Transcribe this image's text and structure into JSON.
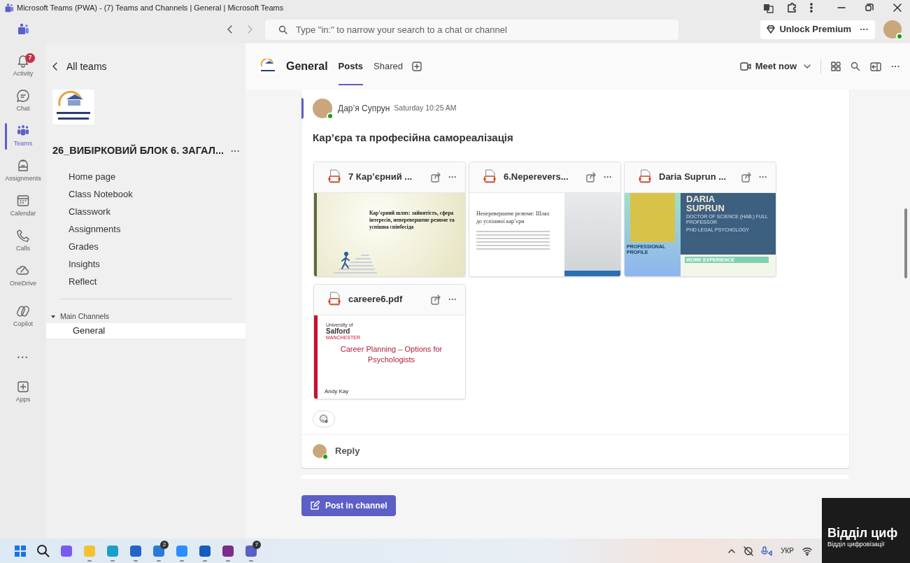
{
  "window": {
    "title": "Microsoft Teams (PWA) - (7) Teams and Channels | General | Microsoft Teams"
  },
  "top_bar": {
    "search": {
      "placeholder": "Type \"in:\" to narrow your search to a chat or channel"
    },
    "premium_button": "Unlock Premium",
    "more": "···"
  },
  "app_rail": [
    {
      "label": "Activity",
      "badge": "7",
      "selected": false
    },
    {
      "label": "Chat",
      "selected": false
    },
    {
      "label": "Teams",
      "selected": true
    },
    {
      "label": "Assignments",
      "selected": false
    },
    {
      "label": "Calendar",
      "selected": false
    },
    {
      "label": "Calls",
      "selected": false
    },
    {
      "label": "OneDrive",
      "selected": false
    },
    {
      "label": "Copilot",
      "selected": false
    },
    {
      "label": "···",
      "selected": false
    },
    {
      "label": "Apps",
      "selected": false
    }
  ],
  "team_panel": {
    "back": "All teams",
    "team_name": "26_ВИБІРКОВИЙ БЛОК 6. ЗАГАЛ...",
    "team_more": "···",
    "items": [
      {
        "label": "Home page"
      },
      {
        "label": "Class Notebook"
      },
      {
        "label": "Classwork"
      },
      {
        "label": "Assignments"
      },
      {
        "label": "Grades"
      },
      {
        "label": "Insights"
      },
      {
        "label": "Reflect"
      }
    ],
    "sections": [
      {
        "label": "Main Channels",
        "expanded": true,
        "channels": [
          {
            "label": "General",
            "selected": true
          }
        ]
      }
    ]
  },
  "channel_header": {
    "name": "General",
    "tabs": [
      {
        "label": "Posts",
        "selected": true
      },
      {
        "label": "Shared",
        "selected": false
      }
    ],
    "meet_now": "Meet now",
    "more": "···"
  },
  "post": {
    "author": "Дар’я Супрун",
    "time": "Saturday 10:25 AM",
    "subject": "Кар’єра та професійна самореалізація",
    "attachments": [
      {
        "name": "7 Кар’єрний ...",
        "more": "···",
        "preview": {
          "kind": "career_path",
          "title": "Кар’єрний шлях:  зайнятість, сфера інтересів, неперевершене резюме та успішна співбесіда"
        }
      },
      {
        "name": "6.Neperevers...",
        "more": "···",
        "preview": {
          "kind": "resume",
          "title": "Неперевершене резюме: Шлях до успішної кар’єри"
        }
      },
      {
        "name": "Daria Suprun ...",
        "more": "···",
        "preview": {
          "kind": "cv",
          "first_name": "DARIA",
          "last_name": "SUPRUN",
          "degree": "DOCTOR OF SCIENCE (HAB.) FULL PROFESSOR",
          "field": "PHD LEGAL PSYCHOLOGY",
          "section_1": "WORK EXPERIENCE",
          "section_2": "PROFESSIONAL PROFILE"
        }
      },
      {
        "name": "careere6.pdf",
        "more": "···",
        "preview": {
          "kind": "salford",
          "logo_top": "University of",
          "logo_main": "Salford",
          "logo_bottom": "MANCHESTER",
          "title": "Career Planning – Options for Psychologists",
          "author": "Andy Kay"
        }
      }
    ],
    "reply": "Reply"
  },
  "post_button": "Post in channel",
  "overlay_window": {
    "heading": "Відділ циф",
    "caption": "Відділ цифровізації"
  },
  "taskbar": {
    "badges": [
      "2",
      "7"
    ],
    "language": "УКР"
  }
}
